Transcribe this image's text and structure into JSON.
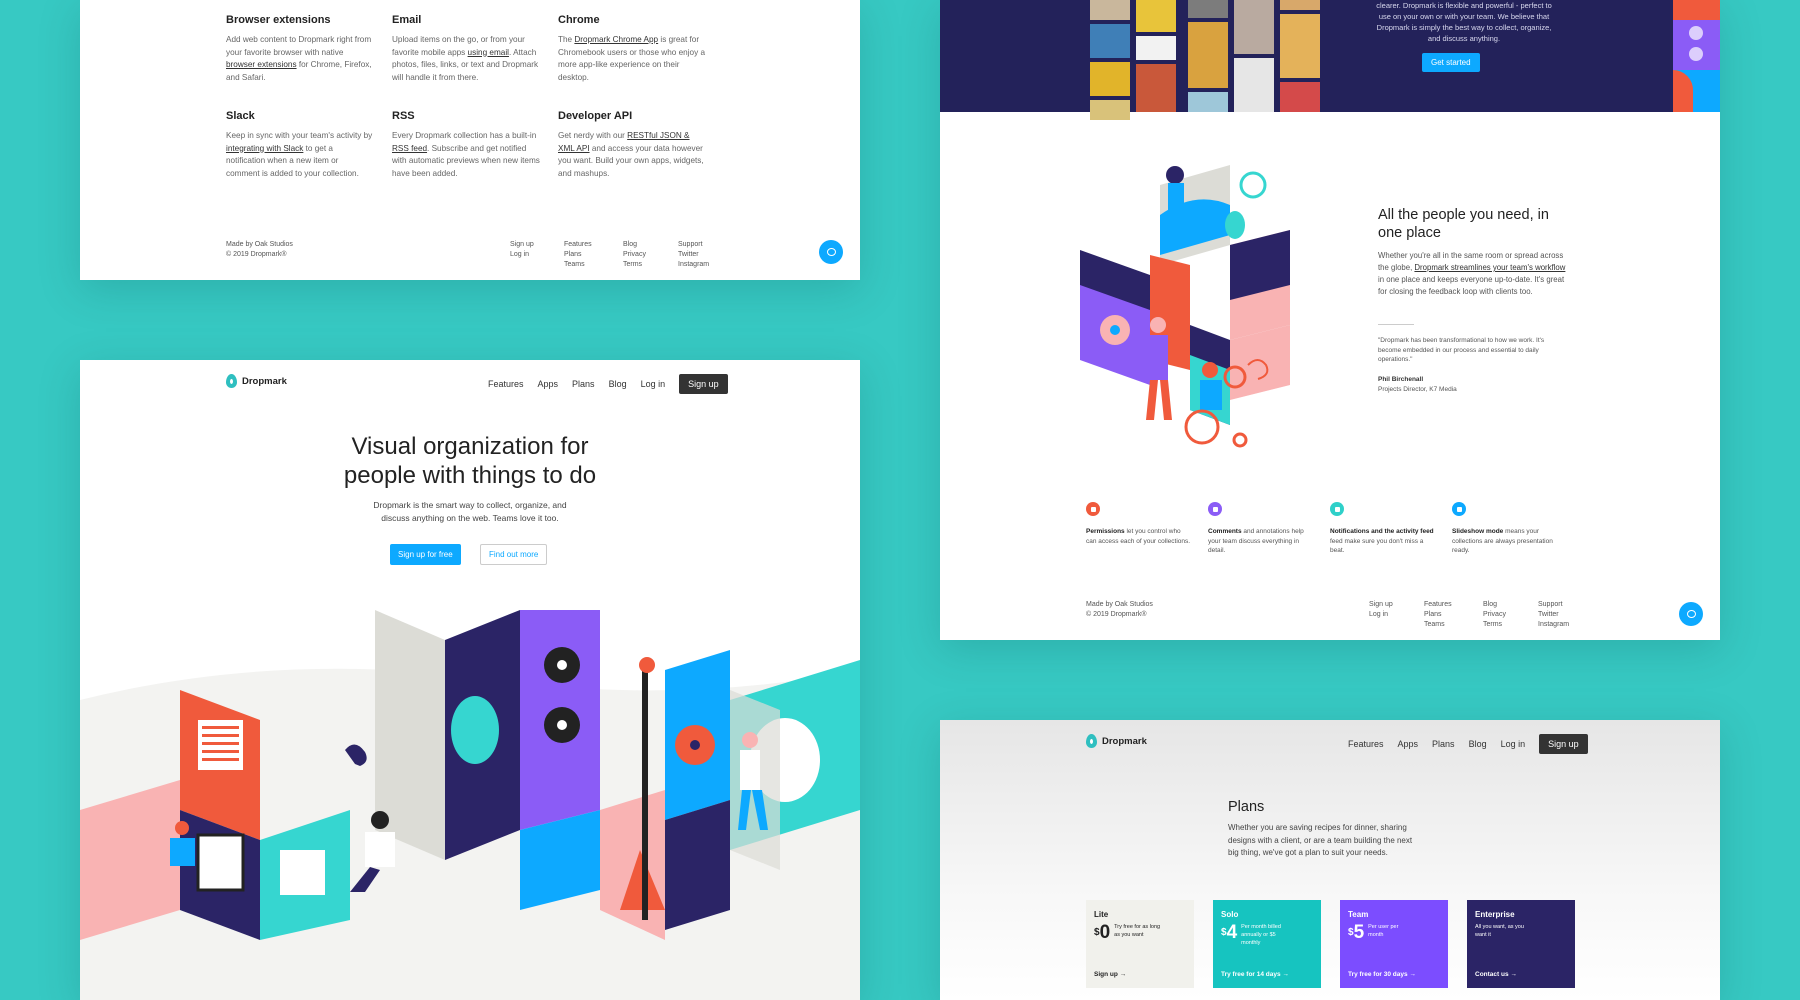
{
  "top_left": {
    "integrations": [
      {
        "title": "Browser extensions",
        "text_before": "Add web content to Dropmark right from your favorite browser with native ",
        "link": "browser extensions",
        "text_after": " for Chrome, Firefox, and Safari."
      },
      {
        "title": "Email",
        "text_before": "Upload items on the go, or from your favorite mobile apps ",
        "link": "using email",
        "text_after": ". Attach photos, files, links, or text and Dropmark will handle it from there."
      },
      {
        "title": "Chrome",
        "text_before": "The ",
        "link": "Dropmark Chrome App",
        "text_after": " is great for Chromebook users or those who enjoy a more app-like experience on their desktop."
      },
      {
        "title": "Slack",
        "text_before": "Keep in sync with your team's activity by ",
        "link": "integrating with Slack",
        "text_after": " to get a notification when a new item or comment is added to your collection."
      },
      {
        "title": "RSS",
        "text_before": "Every Dropmark collection has a built-in ",
        "link": "RSS feed",
        "text_after": ". Subscribe and get notified with automatic previews when new items have been added."
      },
      {
        "title": "Developer API",
        "text_before": "Get nerdy with our ",
        "link": "RESTful JSON & XML API",
        "text_after": " and access your data however you want. Build your own apps, widgets, and mashups."
      }
    ]
  },
  "footer": {
    "made_by": "Made by Oak Studios",
    "copyright": "© 2019 Dropmark®",
    "col1": [
      "Sign up",
      "Log in"
    ],
    "col2": [
      "Features",
      "Plans",
      "Teams"
    ],
    "col3": [
      "Blog",
      "Privacy",
      "Terms"
    ],
    "col4": [
      "Support",
      "Twitter",
      "Instagram"
    ]
  },
  "brand": {
    "name": "Dropmark",
    "accent": "#0da9ff",
    "teal": "#37c9c3",
    "navy": "#23225a"
  },
  "nav": {
    "features": "Features",
    "apps": "Apps",
    "plans": "Plans",
    "blog": "Blog",
    "login": "Log in",
    "signup": "Sign up"
  },
  "hero": {
    "title_line1": "Visual organization for",
    "title_line2": "people with things to do",
    "sub_line1": "Dropmark is the smart way to collect, organize, and",
    "sub_line2": "discuss anything on the web. Teams love it too.",
    "primary_cta": "Sign up for free",
    "secondary_cta": "Find out more"
  },
  "band": {
    "line1": "clearer. Dropmark is flexible and powerful - perfect to",
    "line2": "use on your own or with your team. We believe that",
    "line3": "Dropmark is simply the best way to collect, organize,",
    "line4": "and discuss anything.",
    "cta": "Get started"
  },
  "people": {
    "title_line1": "All the people you need, in",
    "title_line2": "one place",
    "body_before": "Whether you're all in the same room or spread across the globe, ",
    "body_link": "Dropmark streamlines your team's workflow",
    "body_after": " in one place and keeps everyone up-to-date. It's great for closing the feedback loop with clients too.",
    "quote": "\"Dropmark has been transformational to how we work. It's become embedded in our process and essential to daily operations.\"",
    "name": "Phil Birchenall",
    "role": "Projects Director, K7 Media"
  },
  "features": [
    {
      "bold": "Permissions",
      "text": " let you control who can access each of your collections.",
      "icon": "lock-icon",
      "color": "#f05a3c"
    },
    {
      "bold": "Comments",
      "text": " and annotations help your team discuss everything in detail.",
      "icon": "comment-icon",
      "color": "#8b5cf6"
    },
    {
      "bold": "Notifications and the activity feed",
      "text": " feed make sure you don't miss a beat.",
      "icon": "bolt-icon",
      "color": "#2fd0c9"
    },
    {
      "bold": "Slideshow mode",
      "text": " means your collections are always presentation ready.",
      "icon": "play-icon",
      "color": "#0da9ff"
    }
  ],
  "plans": {
    "title": "Plans",
    "sub_line1": "Whether you are saving recipes for dinner, sharing",
    "sub_line2": "designs with a client, or are a team building the next",
    "sub_line3": "big thing, we've got a plan to suit your needs.",
    "cards": [
      {
        "name": "Lite",
        "currency": "$",
        "amount": "0",
        "note": "Try free for as long as you want",
        "cta": "Sign up →",
        "bg": "#f1f1ec",
        "fg": "#222"
      },
      {
        "name": "Solo",
        "currency": "$",
        "amount": "4",
        "note": "Per month billed annually or $5 monthly",
        "cta": "Try free for 14 days →",
        "bg": "#16c4c0",
        "fg": "#fff"
      },
      {
        "name": "Team",
        "currency": "$",
        "amount": "5",
        "note": "Per user per month",
        "cta": "Try free for 30 days →",
        "bg": "#7c4dff",
        "fg": "#fff"
      },
      {
        "name": "Enterprise",
        "currency": "",
        "amount": "",
        "note": "All you want, as you want it",
        "cta": "Contact us →",
        "bg": "#2b2466",
        "fg": "#fff"
      }
    ]
  }
}
